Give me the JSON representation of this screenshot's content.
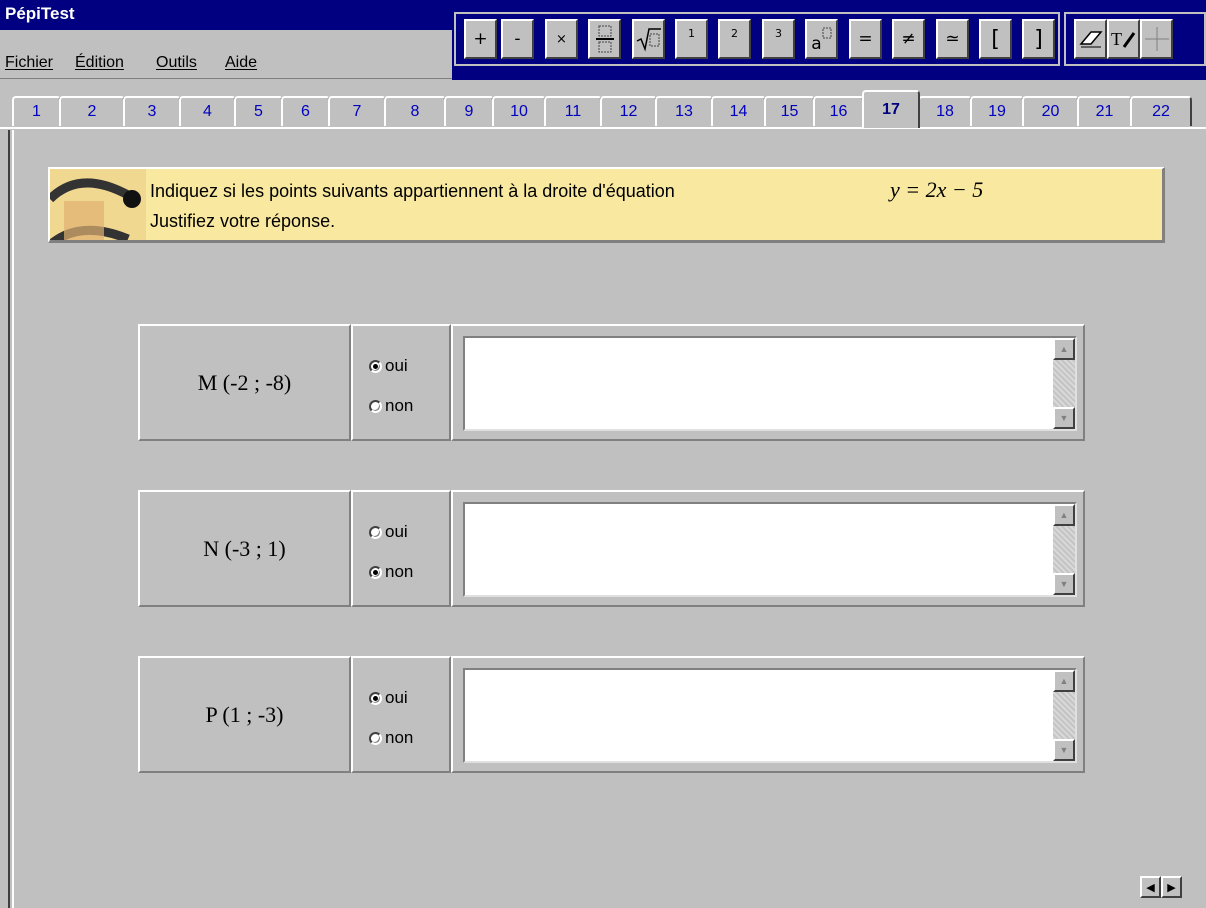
{
  "window": {
    "title": "PépiTest"
  },
  "menu": [
    "Fichier",
    "Édition",
    "Outils",
    "Aide"
  ],
  "toolbar": {
    "math": [
      {
        "icon": "plus-icon",
        "label": "+"
      },
      {
        "icon": "minus-icon",
        "label": "-"
      },
      {
        "icon": "times-icon",
        "label": "×"
      },
      {
        "icon": "fraction-icon",
        "label": ""
      },
      {
        "icon": "sqrt-icon",
        "label": ""
      },
      {
        "icon": "superscript-1-icon",
        "label": "1"
      },
      {
        "icon": "superscript-2-icon",
        "label": "2"
      },
      {
        "icon": "superscript-3-icon",
        "label": "3"
      },
      {
        "icon": "power-icon",
        "label": "a"
      },
      {
        "icon": "equals-icon",
        "label": "="
      },
      {
        "icon": "not-equal-icon",
        "label": "≠"
      },
      {
        "icon": "approx-icon",
        "label": "≃"
      },
      {
        "icon": "open-bracket-icon",
        "label": "["
      },
      {
        "icon": "close-bracket-icon",
        "label": "]"
      }
    ],
    "tools": [
      {
        "icon": "eraser-icon"
      },
      {
        "icon": "text-pen-icon",
        "label": "T"
      },
      {
        "icon": "crosshair-icon"
      }
    ]
  },
  "tabs": [
    "1",
    "2",
    "3",
    "4",
    "5",
    "6",
    "7",
    "8",
    "9",
    "10",
    "11",
    "12",
    "13",
    "14",
    "15",
    "16",
    "17",
    "18",
    "19",
    "20",
    "21",
    "22"
  ],
  "active_tab": "17",
  "instruction": {
    "line1": "Indiquez si les points suivants appartiennent à la droite d'équation",
    "equation": "y = 2x − 5",
    "line2": "Justifiez votre réponse."
  },
  "rows": [
    {
      "point": "M (-2 ; -8)",
      "oui": "oui",
      "non": "non",
      "selected": "oui",
      "answer": ""
    },
    {
      "point": "N (-3 ; 1)",
      "oui": "oui",
      "non": "non",
      "selected": "non",
      "answer": ""
    },
    {
      "point": "P (1 ; -3)",
      "oui": "oui",
      "non": "non",
      "selected": "oui",
      "answer": ""
    }
  ],
  "colors": {
    "titlebar": "#000080",
    "face": "#c0c0c0",
    "banner": "#f8e8a0",
    "tab_text": "#0000c0"
  }
}
